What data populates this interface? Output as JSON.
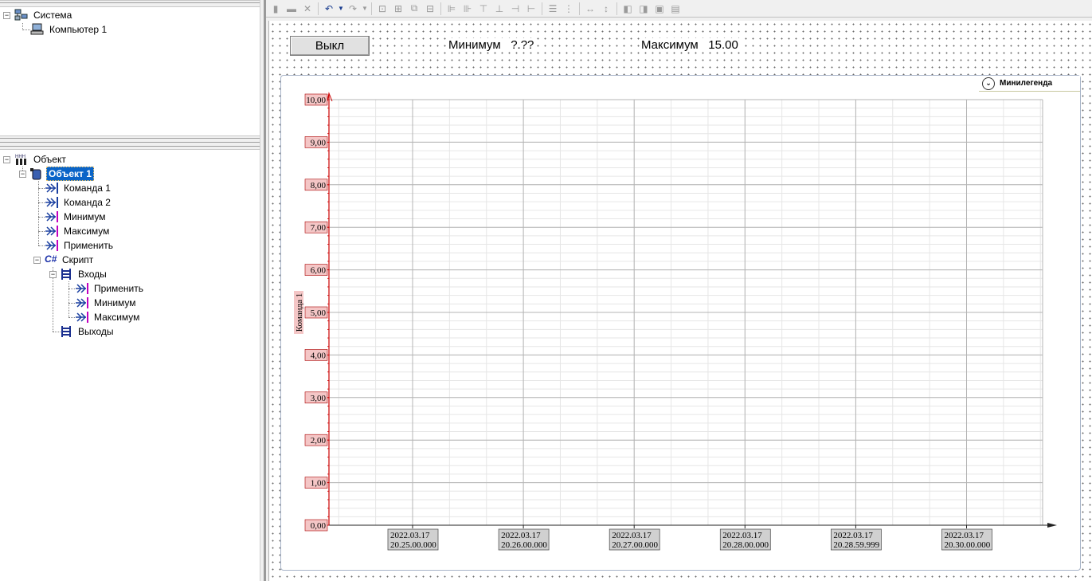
{
  "system_tree": {
    "root": "Система",
    "computer": "Компьютер 1"
  },
  "object_tree": {
    "root": "Объект",
    "object": "Объект 1",
    "items": [
      "Команда 1",
      "Команда 2",
      "Минимум",
      "Максимум",
      "Применить"
    ],
    "script": "Скрипт",
    "script_badge": "C#",
    "inputs": "Входы",
    "inputs_items": [
      "Применить",
      "Минимум",
      "Максимум"
    ],
    "outputs": "Выходы"
  },
  "toolbar": {
    "icons": [
      "copy-icon",
      "paste-icon",
      "cut-icon",
      "undo-icon",
      "dropdown-icon",
      "redo-icon",
      "dropdown-icon",
      "group-icon",
      "ungroup-icon",
      "regroup-icon",
      "dock-icon",
      "align-left-icon",
      "align-right-icon",
      "align-top-icon",
      "align-bottom-icon",
      "center-h-icon",
      "center-v-icon",
      "spacing-h-icon",
      "spacing-v-icon",
      "same-width-icon",
      "same-height-icon",
      "bring-front-icon",
      "send-back-icon",
      "forward-icon",
      "backward-icon"
    ]
  },
  "canvas": {
    "off_button": "Выкл",
    "min_label": "Минимум",
    "min_value": "?.??",
    "max_label": "Максимум",
    "max_value": "15.00"
  },
  "chart_data": {
    "type": "line",
    "title": "",
    "ylabel": "Команда 1",
    "xlabel": "",
    "ylim": [
      0,
      10
    ],
    "y_ticks": [
      "0,00",
      "1,00",
      "2,00",
      "3,00",
      "4,00",
      "5,00",
      "6,00",
      "7,00",
      "8,00",
      "9,00",
      "10,00"
    ],
    "x_ticks": [
      {
        "date": "2022.03.17",
        "time": "20.25.00.000"
      },
      {
        "date": "2022.03.17",
        "time": "20.26.00.000"
      },
      {
        "date": "2022.03.17",
        "time": "20.27.00.000"
      },
      {
        "date": "2022.03.17",
        "time": "20.28.00.000"
      },
      {
        "date": "2022.03.17",
        "time": "20.28.59.999"
      },
      {
        "date": "2022.03.17",
        "time": "20.30.00.000"
      }
    ],
    "series": [],
    "grid": true,
    "minilegend": "Минилегенда",
    "colors": {
      "axis": "#cc0000",
      "label_bg": "#f4c6c6",
      "xlabel_bg": "#d0d0d0"
    }
  }
}
